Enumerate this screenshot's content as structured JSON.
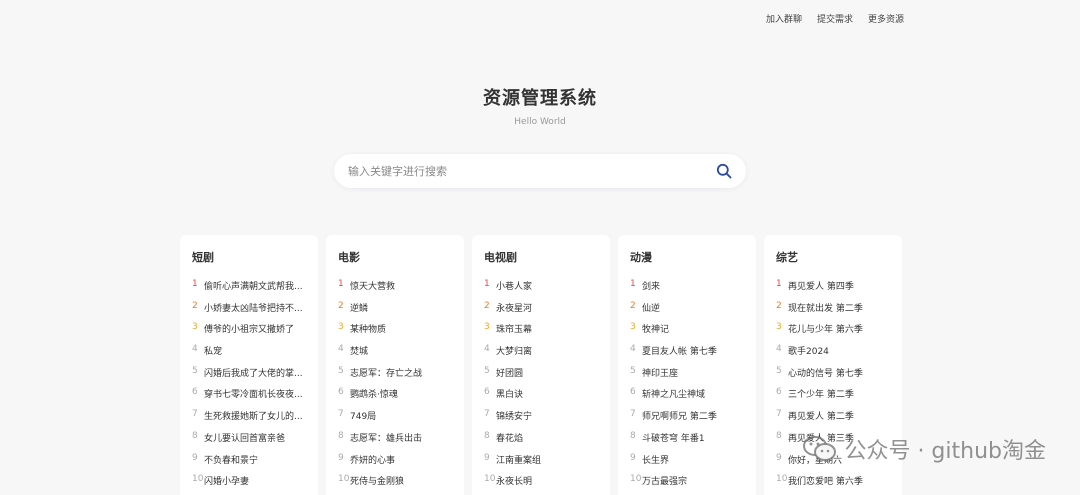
{
  "nav": {
    "items": [
      "加入群聊",
      "提交需求",
      "更多资源"
    ]
  },
  "header": {
    "title": "资源管理系统",
    "subtitle": "Hello World"
  },
  "search": {
    "placeholder": "输入关键字进行搜索",
    "value": ""
  },
  "categories": [
    {
      "title": "短剧",
      "items": [
        "偷听心声满朝文武帮我...",
        "小娇妻太凶陆爷把持不...",
        "傅爷的小祖宗又撒娇了",
        "私宠",
        "闪婚后我成了大佬的掌...",
        "穿书七零冷面机长夜夜...",
        "生死救援她斯了女儿的...",
        "女儿要认回首富亲爸",
        "不负春和景宁",
        "闪婚小孕妻"
      ]
    },
    {
      "title": "电影",
      "items": [
        "惊天大营救",
        "逆鳞",
        "某种物质",
        "焚城",
        "志愿军：存亡之战",
        "鹦鹉杀·惊魂",
        "749局",
        "志愿军：雄兵出击",
        "乔妍的心事",
        "死侍与金刚狼"
      ]
    },
    {
      "title": "电视剧",
      "items": [
        "小巷人家",
        "永夜星河",
        "珠帘玉幕",
        "大梦归离",
        "好团圆",
        "黑白诀",
        "锦绣安宁",
        "春花焰",
        "江南重案组",
        "永夜长明"
      ]
    },
    {
      "title": "动漫",
      "items": [
        "剑来",
        "仙逆",
        "牧神记",
        "夏目友人帐 第七季",
        "神印王座",
        "斩神之凡尘神域",
        "师兄啊师兄 第二季",
        "斗破苍穹 年番1",
        "长生界",
        "万古最强宗"
      ]
    },
    {
      "title": "综艺",
      "items": [
        "再见爱人 第四季",
        "现在就出发 第二季",
        "花儿与少年 第六季",
        "歌手2024",
        "心动的信号 第七季",
        "三个少年 第二季",
        "再见爱人 第二季",
        "再见爱人 第三季",
        "你好，星期六",
        "我们恋爱吧 第六季"
      ]
    }
  ],
  "watermark": {
    "text": "公众号 · github淘金"
  }
}
